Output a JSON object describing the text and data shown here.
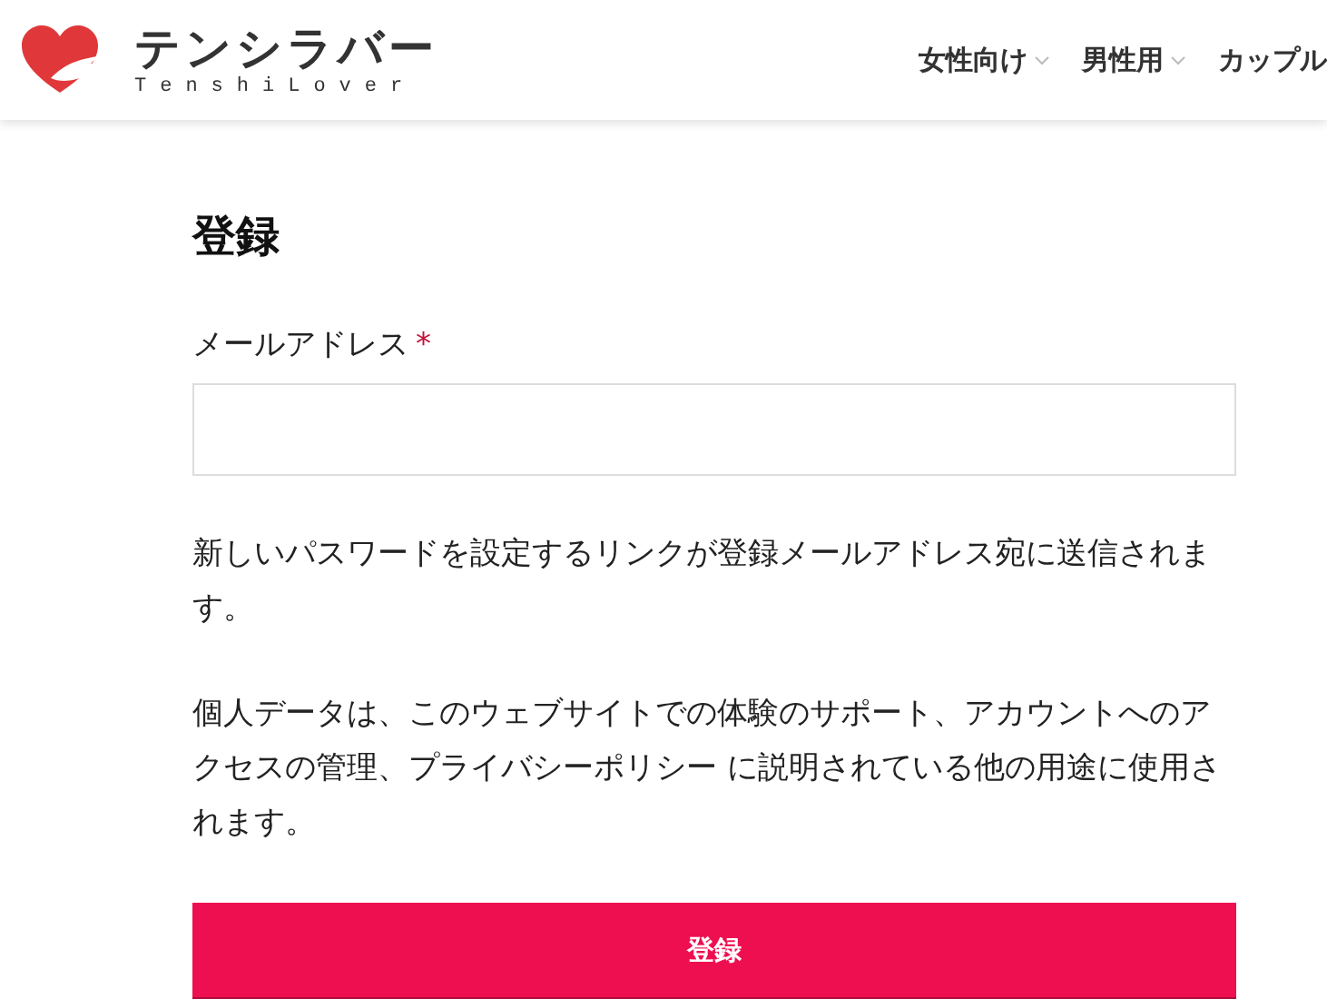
{
  "header": {
    "logo_title": "テンシラバー",
    "logo_subtitle": "TenshiLover",
    "nav": [
      {
        "label": "女性向け",
        "has_submenu": true
      },
      {
        "label": "男性用",
        "has_submenu": true
      },
      {
        "label": "カップル",
        "has_submenu": false
      }
    ]
  },
  "form": {
    "title": "登録",
    "email_label": "メールアドレス",
    "required_mark": "*",
    "notice": "新しいパスワードを設定するリンクが登録メールアドレス宛に送信されます。",
    "privacy": "個人データは、このウェブサイトでの体験のサポート、アカウントへのアクセスの管理、プライバシーポリシー に説明されている他の用途に使用されます。",
    "submit": "登録"
  }
}
